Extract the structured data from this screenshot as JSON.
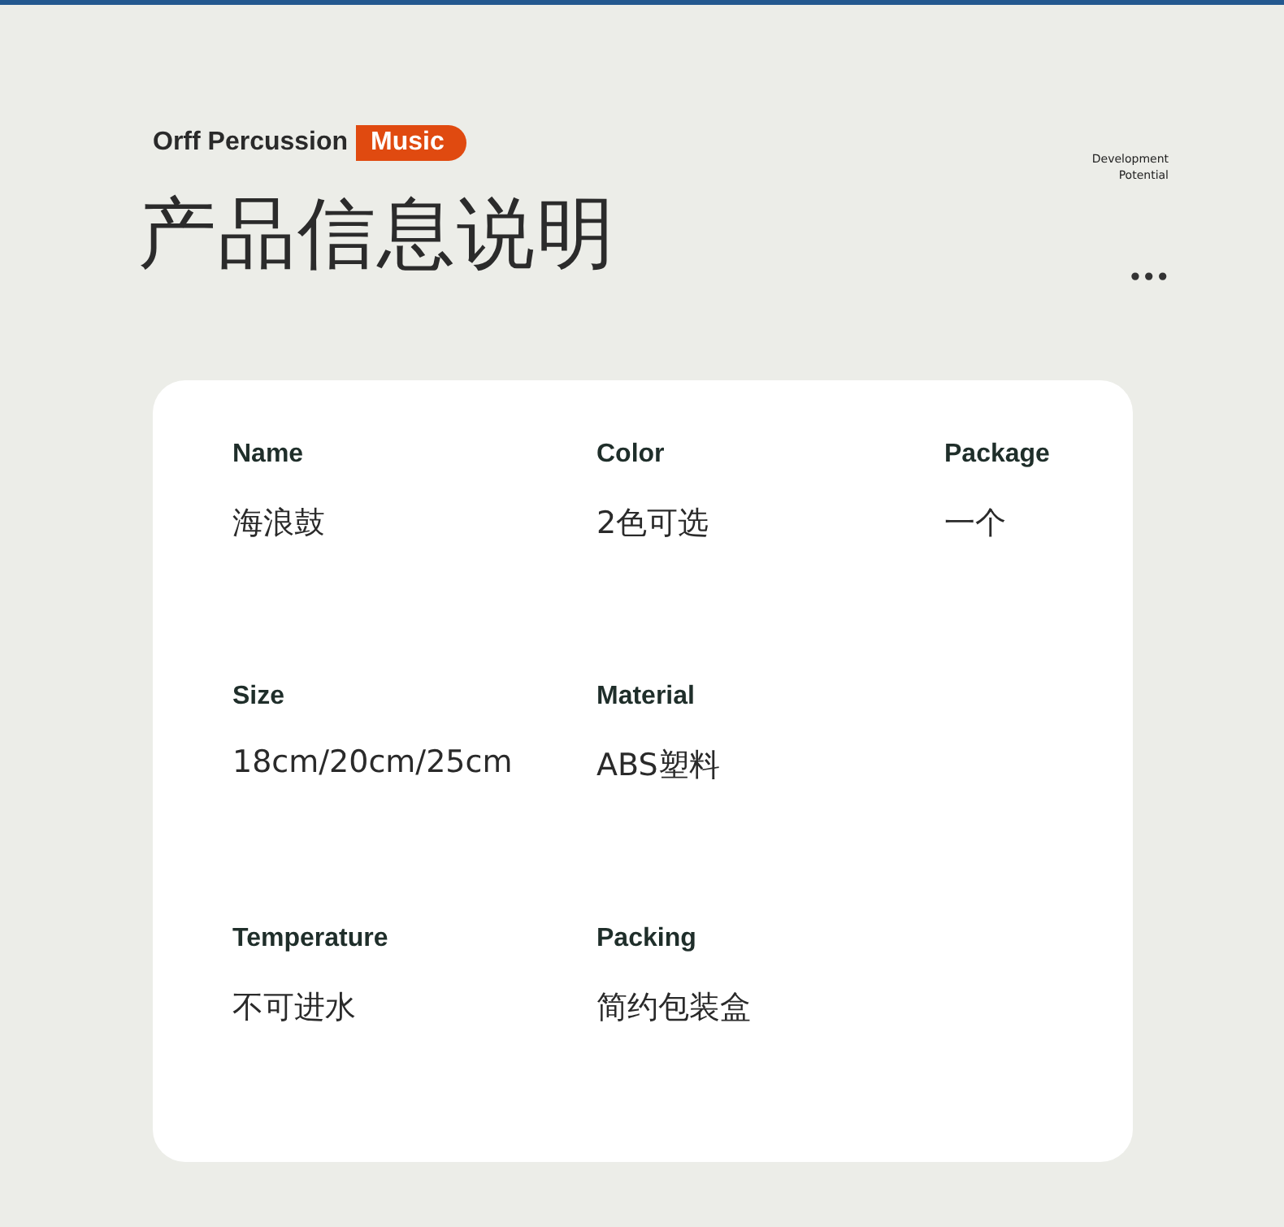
{
  "header": {
    "brand": "Orff Percussion",
    "tag": "Music",
    "tagline": [
      "Development",
      "Potential"
    ],
    "title": "产品信息说明",
    "more": "•••"
  },
  "specs": [
    [
      {
        "label": "Name",
        "value": "海浪鼓"
      },
      {
        "label": "Color",
        "value": "2色可选"
      },
      {
        "label": "Package",
        "value": "一个"
      }
    ],
    [
      {
        "label": "Size",
        "value": "18cm/20cm/25cm"
      },
      {
        "label": "Material",
        "value": "ABS塑料"
      }
    ],
    [
      {
        "label": "Temperature",
        "value": "不可进水"
      },
      {
        "label": "Packing",
        "value": "简约包装盒"
      }
    ]
  ]
}
